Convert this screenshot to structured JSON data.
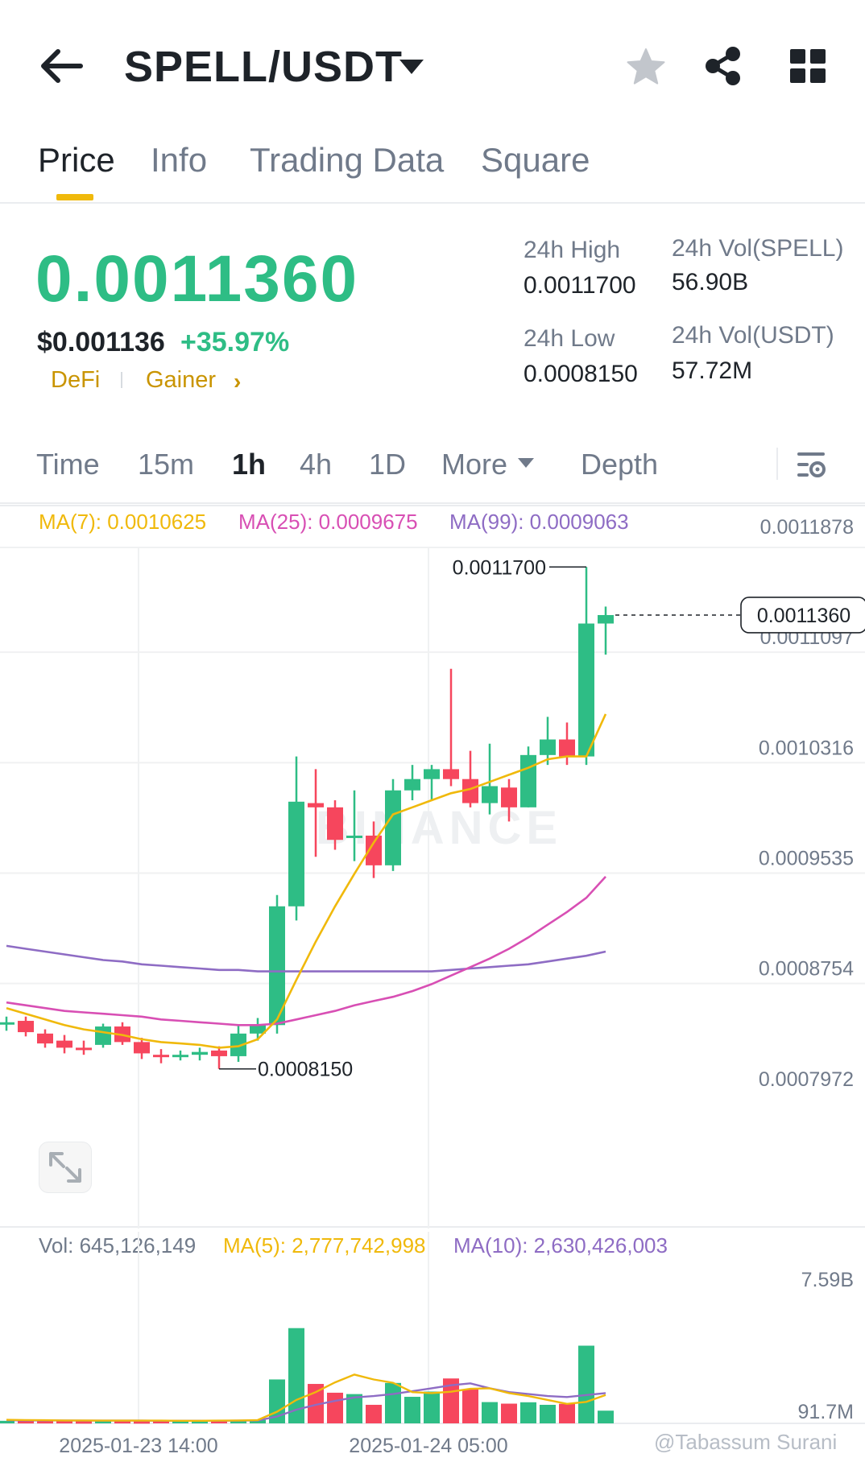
{
  "header": {
    "pair": "SPELL/USDT",
    "icons": [
      "back-arrow-icon",
      "caret-down-icon",
      "star-icon",
      "share-icon",
      "grid-icon"
    ]
  },
  "tabs": [
    {
      "label": "Price",
      "active": true
    },
    {
      "label": "Info",
      "active": false
    },
    {
      "label": "Trading Data",
      "active": false
    },
    {
      "label": "Square",
      "active": false
    }
  ],
  "price": {
    "last": "0.0011360",
    "usd": "$0.001136",
    "change": "+35.97%",
    "tags": [
      "DeFi",
      "Gainer"
    ],
    "tag_chevron": "›"
  },
  "stats": {
    "high_label": "24h High",
    "high": "0.0011700",
    "low_label": "24h Low",
    "low": "0.0008150",
    "vol_base_label": "24h Vol(SPELL)",
    "vol_base": "56.90B",
    "vol_quote_label": "24h Vol(USDT)",
    "vol_quote": "57.72M"
  },
  "intervals": [
    {
      "label": "Time",
      "active": false
    },
    {
      "label": "15m",
      "active": false
    },
    {
      "label": "1h",
      "active": true
    },
    {
      "label": "4h",
      "active": false
    },
    {
      "label": "1D",
      "active": false
    },
    {
      "label": "More",
      "active": false
    },
    {
      "label": "Depth",
      "active": false
    }
  ],
  "ma_legend": {
    "ma7": "MA(7): 0.0010625",
    "ma25": "MA(25): 0.0009675",
    "ma99": "MA(99): 0.0009063"
  },
  "vol_legend": {
    "vol": "Vol: 645,126,149",
    "ma5": "MA(5): 2,777,742,998",
    "ma10": "MA(10): 2,630,426,003"
  },
  "watermark_chart": "BINANCE",
  "watermark_credit": "@Tabassum Surani",
  "colors": {
    "up": "#2ebd85",
    "down": "#f6465d",
    "ma7": "#f0b90b",
    "ma25": "#d84fb4",
    "ma99": "#8e6cc4",
    "accent": "#f0b90b",
    "text": "#1e2329",
    "muted": "#707a8a"
  },
  "chart_data": {
    "type": "candlestick",
    "interval": "1h",
    "y_ticks": [
      "0.0011878",
      "0.0011097",
      "0.0010316",
      "0.0009535",
      "0.0008754",
      "0.0007972"
    ],
    "ylim": [
      0.0007972,
      0.0011878
    ],
    "x_ticks": [
      "2025-01-23 14:00",
      "2025-01-24 05:00"
    ],
    "current_price_label": "0.0011360",
    "current_price": 0.001136,
    "annotations": [
      {
        "text": "0.0011700",
        "value": 0.00117,
        "candle": 30
      },
      {
        "text": "0.0008150",
        "value": 0.000815,
        "candle": 11
      }
    ],
    "candles": [
      {
        "o": 0.000848,
        "h": 0.000852,
        "l": 0.000842,
        "c": 0.000848
      },
      {
        "o": 0.000849,
        "h": 0.000852,
        "l": 0.000838,
        "c": 0.000841
      },
      {
        "o": 0.00084,
        "h": 0.000843,
        "l": 0.00083,
        "c": 0.000833
      },
      {
        "o": 0.000835,
        "h": 0.000839,
        "l": 0.000826,
        "c": 0.00083
      },
      {
        "o": 0.00083,
        "h": 0.000835,
        "l": 0.000825,
        "c": 0.000829
      },
      {
        "o": 0.000832,
        "h": 0.000847,
        "l": 0.00083,
        "c": 0.000845
      },
      {
        "o": 0.000845,
        "h": 0.000848,
        "l": 0.000832,
        "c": 0.000834
      },
      {
        "o": 0.000834,
        "h": 0.000837,
        "l": 0.000822,
        "c": 0.000826
      },
      {
        "o": 0.000825,
        "h": 0.000829,
        "l": 0.000819,
        "c": 0.000824
      },
      {
        "o": 0.000824,
        "h": 0.000828,
        "l": 0.000821,
        "c": 0.000825
      },
      {
        "o": 0.000825,
        "h": 0.00083,
        "l": 0.000821,
        "c": 0.000827
      },
      {
        "o": 0.000828,
        "h": 0.000831,
        "l": 0.000815,
        "c": 0.000824
      },
      {
        "o": 0.000824,
        "h": 0.000846,
        "l": 0.00082,
        "c": 0.00084
      },
      {
        "o": 0.00084,
        "h": 0.000851,
        "l": 0.000835,
        "c": 0.000846
      },
      {
        "o": 0.000846,
        "h": 0.000938,
        "l": 0.00084,
        "c": 0.00093
      },
      {
        "o": 0.00093,
        "h": 0.001036,
        "l": 0.00092,
        "c": 0.001004
      },
      {
        "o": 0.001003,
        "h": 0.001027,
        "l": 0.000965,
        "c": 0.001
      },
      {
        "o": 0.001,
        "h": 0.001005,
        "l": 0.00097,
        "c": 0.000977
      },
      {
        "o": 0.00098,
        "h": 0.001012,
        "l": 0.000962,
        "c": 0.00098
      },
      {
        "o": 0.00098,
        "h": 0.00099,
        "l": 0.00095,
        "c": 0.000959
      },
      {
        "o": 0.000959,
        "h": 0.00102,
        "l": 0.000955,
        "c": 0.001012
      },
      {
        "o": 0.001012,
        "h": 0.00103,
        "l": 0.001005,
        "c": 0.00102
      },
      {
        "o": 0.00102,
        "h": 0.00103,
        "l": 0.001005,
        "c": 0.001027
      },
      {
        "o": 0.001027,
        "h": 0.001098,
        "l": 0.001015,
        "c": 0.00102
      },
      {
        "o": 0.00102,
        "h": 0.00104,
        "l": 0.001,
        "c": 0.001003
      },
      {
        "o": 0.001003,
        "h": 0.001045,
        "l": 0.000995,
        "c": 0.001015
      },
      {
        "o": 0.001014,
        "h": 0.00102,
        "l": 0.00099,
        "c": 0.001
      },
      {
        "o": 0.001,
        "h": 0.001043,
        "l": 0.001,
        "c": 0.001037
      },
      {
        "o": 0.001037,
        "h": 0.001064,
        "l": 0.00103,
        "c": 0.001048
      },
      {
        "o": 0.001048,
        "h": 0.00106,
        "l": 0.00103,
        "c": 0.001036
      },
      {
        "o": 0.001036,
        "h": 0.00117,
        "l": 0.00103,
        "c": 0.00113
      },
      {
        "o": 0.00113,
        "h": 0.001142,
        "l": 0.001108,
        "c": 0.001136
      }
    ],
    "ma7": [
      0.000858,
      0.000854,
      0.00085,
      0.000846,
      0.000843,
      0.000841,
      0.000839,
      0.000836,
      0.000834,
      0.000833,
      0.000832,
      0.00083,
      0.000831,
      0.000836,
      0.00085,
      0.000878,
      0.000905,
      0.00093,
      0.000953,
      0.000975,
      0.000995,
      0.001,
      0.001005,
      0.00101,
      0.001013,
      0.001018,
      0.001023,
      0.001028,
      0.001034,
      0.001036,
      0.001036,
      0.001066
    ],
    "ma25": [
      0.000862,
      0.00086,
      0.000858,
      0.000856,
      0.000855,
      0.000854,
      0.000853,
      0.000852,
      0.00085,
      0.000849,
      0.000848,
      0.000847,
      0.000846,
      0.000846,
      0.000847,
      0.00085,
      0.000853,
      0.000856,
      0.00086,
      0.000863,
      0.000866,
      0.00087,
      0.000875,
      0.000881,
      0.000887,
      0.000893,
      0.0009,
      0.000908,
      0.000917,
      0.000926,
      0.000936,
      0.000951
    ],
    "ma99": [
      0.000902,
      0.0009,
      0.000898,
      0.000896,
      0.000894,
      0.000892,
      0.000891,
      0.000889,
      0.000888,
      0.000887,
      0.000886,
      0.000885,
      0.000885,
      0.000884,
      0.000884,
      0.000884,
      0.000884,
      0.000884,
      0.000884,
      0.000884,
      0.000884,
      0.000884,
      0.000884,
      0.000885,
      0.000886,
      0.000887,
      0.000888,
      0.000889,
      0.000891,
      0.000893,
      0.000895,
      0.000898
    ],
    "volume": {
      "y_ticks": [
        "7.59B",
        "91.7M"
      ],
      "ylim": [
        0.0917,
        7.59
      ],
      "unit": "B",
      "bars": [
        0.13,
        0.12,
        0.12,
        0.12,
        0.11,
        0.13,
        0.12,
        0.11,
        0.15,
        0.17,
        0.12,
        0.13,
        0.14,
        0.18,
        2.25,
        4.88,
        2.02,
        1.57,
        1.5,
        0.95,
        2.07,
        1.36,
        1.63,
        2.3,
        1.74,
        1.09,
        1.01,
        1.08,
        0.95,
        1.0,
        3.98,
        0.65
      ],
      "ma5": [
        0.18,
        0.17,
        0.16,
        0.15,
        0.15,
        0.14,
        0.14,
        0.14,
        0.14,
        0.13,
        0.13,
        0.14,
        0.15,
        0.17,
        0.6,
        1.2,
        1.6,
        2.1,
        2.5,
        2.25,
        2.08,
        1.6,
        1.55,
        1.62,
        1.77,
        1.8,
        1.55,
        1.4,
        1.2,
        1.0,
        1.1,
        1.45
      ],
      "ma10": [
        0.16,
        0.15,
        0.15,
        0.15,
        0.14,
        0.14,
        0.14,
        0.14,
        0.13,
        0.13,
        0.13,
        0.13,
        0.14,
        0.15,
        0.35,
        0.7,
        0.95,
        1.15,
        1.33,
        1.4,
        1.5,
        1.65,
        1.8,
        1.95,
        2.05,
        1.8,
        1.6,
        1.5,
        1.4,
        1.35,
        1.45,
        1.55
      ]
    }
  }
}
